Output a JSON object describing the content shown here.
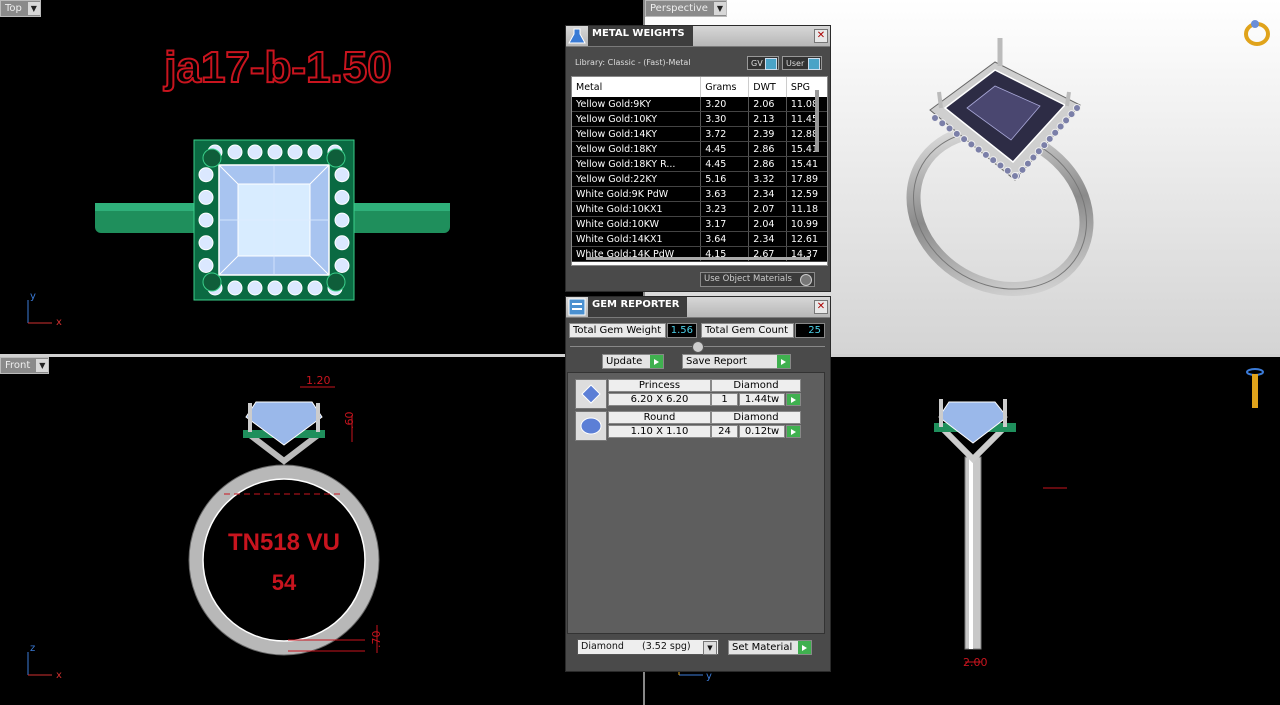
{
  "viewports": {
    "top": {
      "label": "Top",
      "title_text": "ja17-b-1.50",
      "axis_v": "y",
      "axis_h": "x"
    },
    "perspective": {
      "label": "Perspective"
    },
    "front": {
      "label": "Front",
      "ring_text_1": "TN518 VU",
      "ring_text_2": "54",
      "dim_top": "1.20",
      "dim_side": ".60",
      "dim_bottom": ".70",
      "axis_v": "z",
      "axis_h": "x"
    },
    "right": {
      "dim_bottom": "2.00",
      "axis_h": "y"
    }
  },
  "metal_panel": {
    "title": "METAL WEIGHTS",
    "library": "Library: Classic - (Fast)-Metal",
    "gv_label": "GV",
    "user_label": "User",
    "columns": [
      "Metal",
      "Grams",
      "DWT",
      "SPG"
    ],
    "rows": [
      [
        "Yellow Gold:9KY",
        "3.20",
        "2.06",
        "11.08"
      ],
      [
        "Yellow Gold:10KY",
        "3.30",
        "2.13",
        "11.45"
      ],
      [
        "Yellow Gold:14KY",
        "3.72",
        "2.39",
        "12.88"
      ],
      [
        "Yellow Gold:18KY",
        "4.45",
        "2.86",
        "15.41"
      ],
      [
        "Yellow Gold:18KY R...",
        "4.45",
        "2.86",
        "15.41"
      ],
      [
        "Yellow Gold:22KY",
        "5.16",
        "3.32",
        "17.89"
      ],
      [
        "White Gold:9K PdW",
        "3.63",
        "2.34",
        "12.59"
      ],
      [
        "White Gold:10KX1",
        "3.23",
        "2.07",
        "11.18"
      ],
      [
        "White Gold:10KW",
        "3.17",
        "2.04",
        "10.99"
      ],
      [
        "White Gold:14KX1",
        "3.64",
        "2.34",
        "12.61"
      ],
      [
        "White Gold:14K PdW",
        "4.15",
        "2.67",
        "14.37"
      ]
    ],
    "use_object_materials": "Use Object Materials"
  },
  "gem_panel": {
    "title": "GEM REPORTER",
    "total_weight_label": "Total Gem Weight",
    "total_weight_value": "1.56",
    "total_count_label": "Total Gem Count",
    "total_count_value": "25",
    "update_label": "Update",
    "save_report_label": "Save Report",
    "gems": [
      {
        "cut": "Princess",
        "material": "Diamond",
        "size": "6.20 X 6.20",
        "count": "1",
        "weight": "1.44tw"
      },
      {
        "cut": "Round",
        "material": "Diamond",
        "size": "1.10 X 1.10",
        "count": "24",
        "weight": "0.12tw"
      }
    ],
    "material_select": "Diamond      (3.52 spg)",
    "set_material_label": "Set Material"
  },
  "colors": {
    "red_text": "#c8141e",
    "green_metal": "#1f8f5c",
    "accent_green": "#3fb04f",
    "cyan_value": "#4cd0e8"
  }
}
